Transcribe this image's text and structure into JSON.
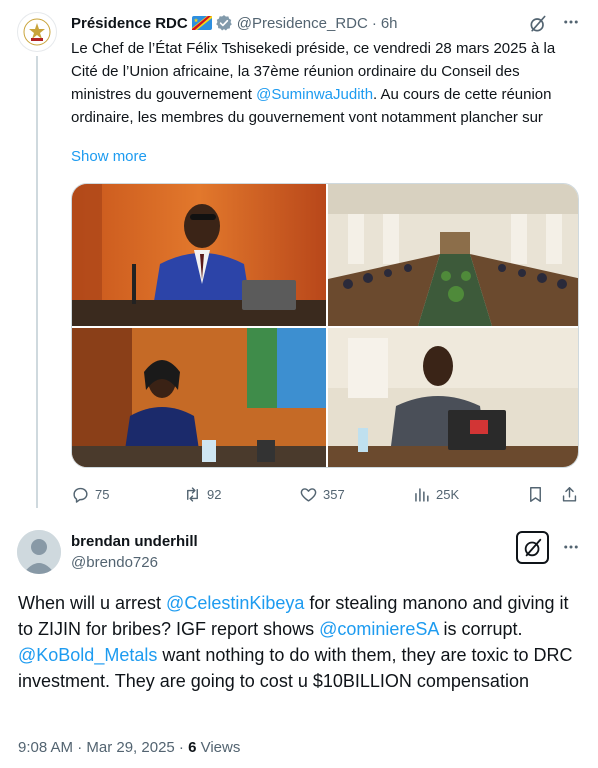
{
  "parent": {
    "display_name": "Présidence RDC",
    "handle": "@Presidence_RDC",
    "separator": "·",
    "time": "6h",
    "text_segments": {
      "t1": "Le Chef de l’État Félix Tshisekedi préside, ce vendredi 28 mars 2025 à la Cité de l’Union africaine, la 37ème réunion ordinaire du Conseil des ministres du gouvernement ",
      "mention": "@SuminwaJudith",
      "t2": ".  Au cours de cette réunion ordinaire, les membres du gouvernement vont notamment plancher sur"
    },
    "show_more": "Show more",
    "media": [
      {
        "name": "media-president-speaking"
      },
      {
        "name": "media-council-room"
      },
      {
        "name": "media-prime-minister"
      },
      {
        "name": "media-minister-signing"
      }
    ],
    "actions": {
      "replies": "75",
      "reposts": "92",
      "likes": "357",
      "views": "25K"
    }
  },
  "reply": {
    "display_name": "brendan underhill",
    "handle": "@brendo726",
    "text_segments": {
      "t1": "When will u arrest ",
      "m1": "@CelestinKibeya",
      "t2": " for stealing manono and giving it to ZIJIN for bribes? IGF report shows ",
      "m2": "@cominiereSA",
      "t3": " is corrupt. ",
      "m3": "@KoBold_Metals",
      "t4": " want nothing to do with them, they are toxic to DRC investment. They are going to cost u $10BILLION compensation"
    },
    "timestamp": "9:08 AM · Mar 29, 2025 · ",
    "views_count": "6",
    "views_label": " Views"
  },
  "icons": [
    "presidence-logo-icon",
    "drc-flag-icon",
    "verified-badge-icon",
    "grok-icon",
    "more-icon",
    "reply-icon",
    "repost-icon",
    "like-icon",
    "views-icon",
    "bookmark-icon",
    "share-icon",
    "default-avatar-icon"
  ],
  "colors": {
    "link": "#1d9bf0",
    "secondary": "#536471",
    "text": "#0f1419",
    "thread_line": "#cfd9de"
  }
}
